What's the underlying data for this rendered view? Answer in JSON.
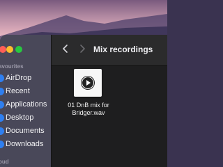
{
  "window": {
    "title": "Mix recordings"
  },
  "sidebar": {
    "favourites_label": "avourites",
    "icloud_label": "oud",
    "items": [
      {
        "label": "AirDrop",
        "icon": "airdrop-icon"
      },
      {
        "label": "Recent",
        "icon": "clock-icon"
      },
      {
        "label": "Applications",
        "icon": "applications-icon"
      },
      {
        "label": "Desktop",
        "icon": "desktop-icon"
      },
      {
        "label": "Documents",
        "icon": "document-icon"
      },
      {
        "label": "Downloads",
        "icon": "download-icon"
      }
    ]
  },
  "files": [
    {
      "name": "01 DnB mix for Bridger.wav",
      "icon": "audio-file-icon"
    }
  ],
  "colors": {
    "close": "#ff5f57",
    "minimize": "#febc2e",
    "maximize": "#28c840",
    "sidebar_icon": "#2f7ff0"
  }
}
